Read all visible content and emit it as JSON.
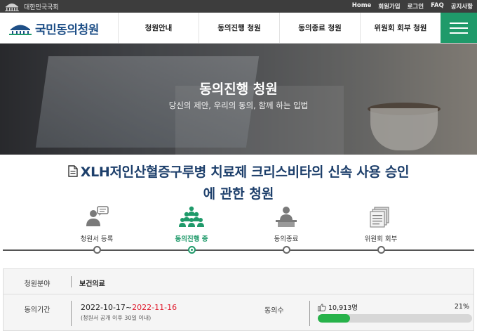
{
  "topbar": {
    "assembly_name": "대한민국국회",
    "links": [
      "Home",
      "회원가입",
      "로그인",
      "FAQ",
      "공지사항"
    ]
  },
  "nav": {
    "logo_text": "국민동의청원",
    "menu": [
      "청원안내",
      "동의진행 청원",
      "동의종료 청원",
      "위원회 회부 청원"
    ]
  },
  "hero": {
    "title": "동의진행 청원",
    "subtitle": "당신의 제안, 우리의 동의, 함께 하는 입법"
  },
  "petition": {
    "title_line1": "XLH저인산혈증구루병 치료제 크리스비타의 신속 사용 승인",
    "title_line2": "에 관한 청원"
  },
  "stepper": {
    "steps": [
      {
        "label": "청원서 등록",
        "icon": "person-speech-icon"
      },
      {
        "label": "동의진행 중",
        "icon": "group-icon"
      },
      {
        "label": "동의종료",
        "icon": "person-desk-icon"
      },
      {
        "label": "위원회 회부",
        "icon": "document-stack-icon"
      }
    ],
    "active_index": 1
  },
  "info": {
    "field_label": "청원분야",
    "field_value": "보건의료",
    "period_label": "동의기간",
    "period_start": "2022-10-17~",
    "period_end": "2022-11-16",
    "period_note": "(청원서 공개 이후 30일 이내)",
    "agree_label": "동의수",
    "agree_count": "10,913명",
    "agree_percent": "21%",
    "agree_fraction": 0.21
  },
  "colors": {
    "brand_green": "#1f9a6a",
    "brand_blue": "#1e4f87",
    "end_date_red": "#e0192b",
    "progress_green": "#27b24a"
  }
}
